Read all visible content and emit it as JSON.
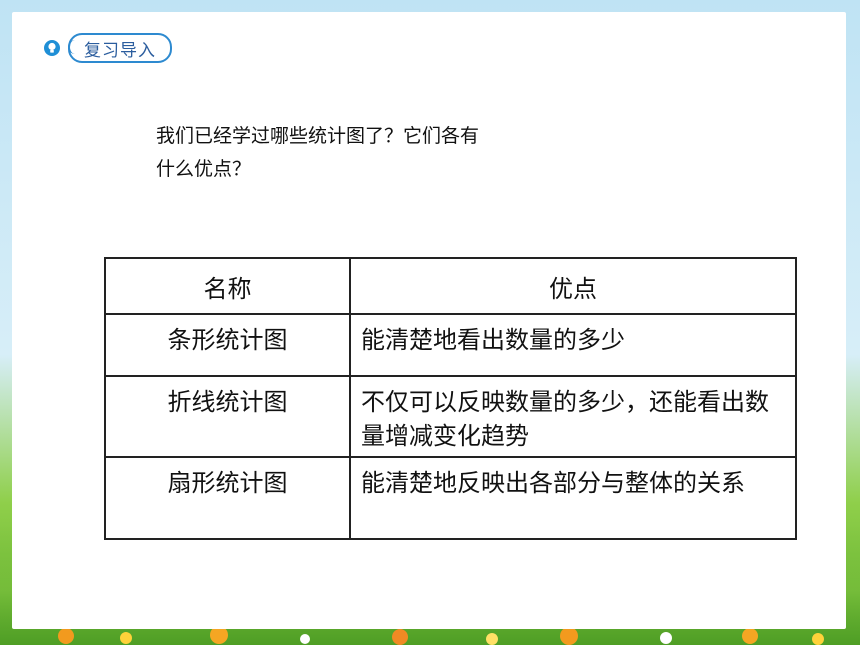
{
  "badge": {
    "label": "复习导入",
    "icon": "bulb-icon",
    "accent": "#2d8ad0"
  },
  "question": {
    "line1": "我们已经学过哪些统计图了？它们各有",
    "line2": "什么优点？"
  },
  "table": {
    "headers": [
      "名称",
      "优点"
    ],
    "rows": [
      {
        "name": "条形统计图",
        "merit": "能清楚地看出数量的多少"
      },
      {
        "name": "折线统计图",
        "merit": "不仅可以反映数量的多少，还能看出数量增减变化趋势"
      },
      {
        "name": "扇形统计图",
        "merit": "能清楚地反映出各部分与整体的关系"
      }
    ]
  }
}
